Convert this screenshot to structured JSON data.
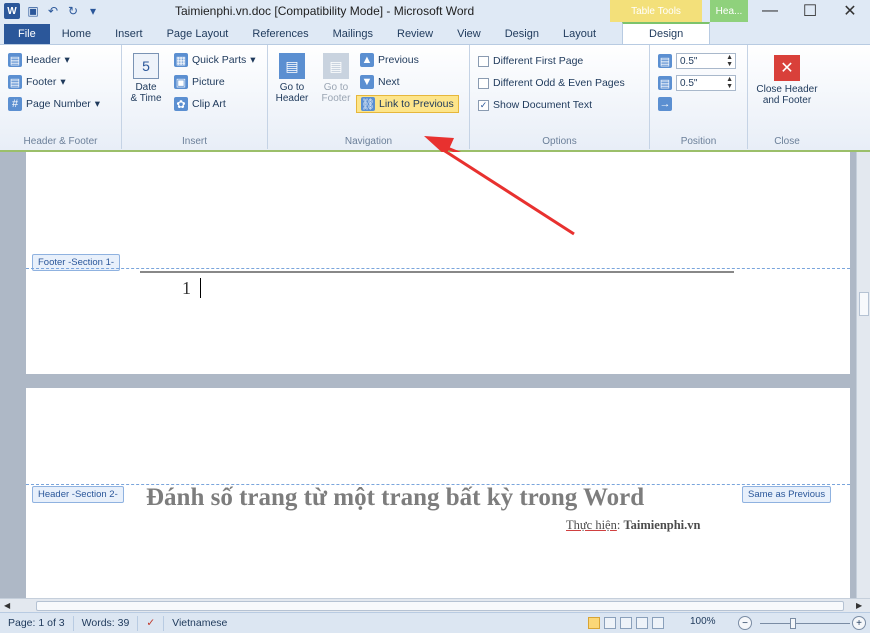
{
  "titlebar": {
    "title": "Taimienphi.vn.doc [Compatibility Mode] - Microsoft Word",
    "table_tools": "Table Tools",
    "hf_tools": "Hea...",
    "minimize": "—",
    "maximize": "☐",
    "close": "✕",
    "qat_icons": [
      "word-logo",
      "save-icon",
      "undo-icon",
      "redo-icon",
      "customize-icon"
    ]
  },
  "tabs": [
    "File",
    "Home",
    "Insert",
    "Page Layout",
    "References",
    "Mailings",
    "Review",
    "View",
    "Design",
    "Layout",
    "Design"
  ],
  "ribbon": {
    "header_footer": {
      "label": "Header & Footer",
      "header": "Header",
      "footer": "Footer",
      "page_number": "Page Number"
    },
    "insert": {
      "label": "Insert",
      "date_time_1": "Date",
      "date_time_2": "& Time",
      "quick_parts": "Quick Parts",
      "picture": "Picture",
      "clip_art": "Clip Art"
    },
    "navigation": {
      "label": "Navigation",
      "goto_header_1": "Go to",
      "goto_header_2": "Header",
      "goto_footer_1": "Go to",
      "goto_footer_2": "Footer",
      "previous": "Previous",
      "next": "Next",
      "link_to_previous": "Link to Previous"
    },
    "options": {
      "label": "Options",
      "different_first_page": "Different First Page",
      "different_odd_even": "Different Odd & Even Pages",
      "show_document_text": "Show Document Text",
      "show_document_text_checked": true
    },
    "position": {
      "label": "Position",
      "header_from_top": "0.5\"",
      "footer_from_bottom": "0.5\""
    },
    "close": {
      "label": "Close",
      "close_1": "Close Header",
      "close_2": "and Footer"
    }
  },
  "document": {
    "footer_tag": "Footer -Section 1-",
    "page_number": "1",
    "header_tag": "Header -Section 2-",
    "same_as_previous": "Same as Previous",
    "heading": "Đánh số trang từ một trang bất kỳ trong Word",
    "sub_prefix": "Thực hiện",
    "sub_colon": ":",
    "sub_name": "Taimienphi.vn"
  },
  "statusbar": {
    "page": "Page: 1 of 3",
    "words": "Words: 39",
    "language": "Vietnamese",
    "zoom": "100%"
  },
  "annotation": {
    "arrow_color": "#e8312f"
  }
}
